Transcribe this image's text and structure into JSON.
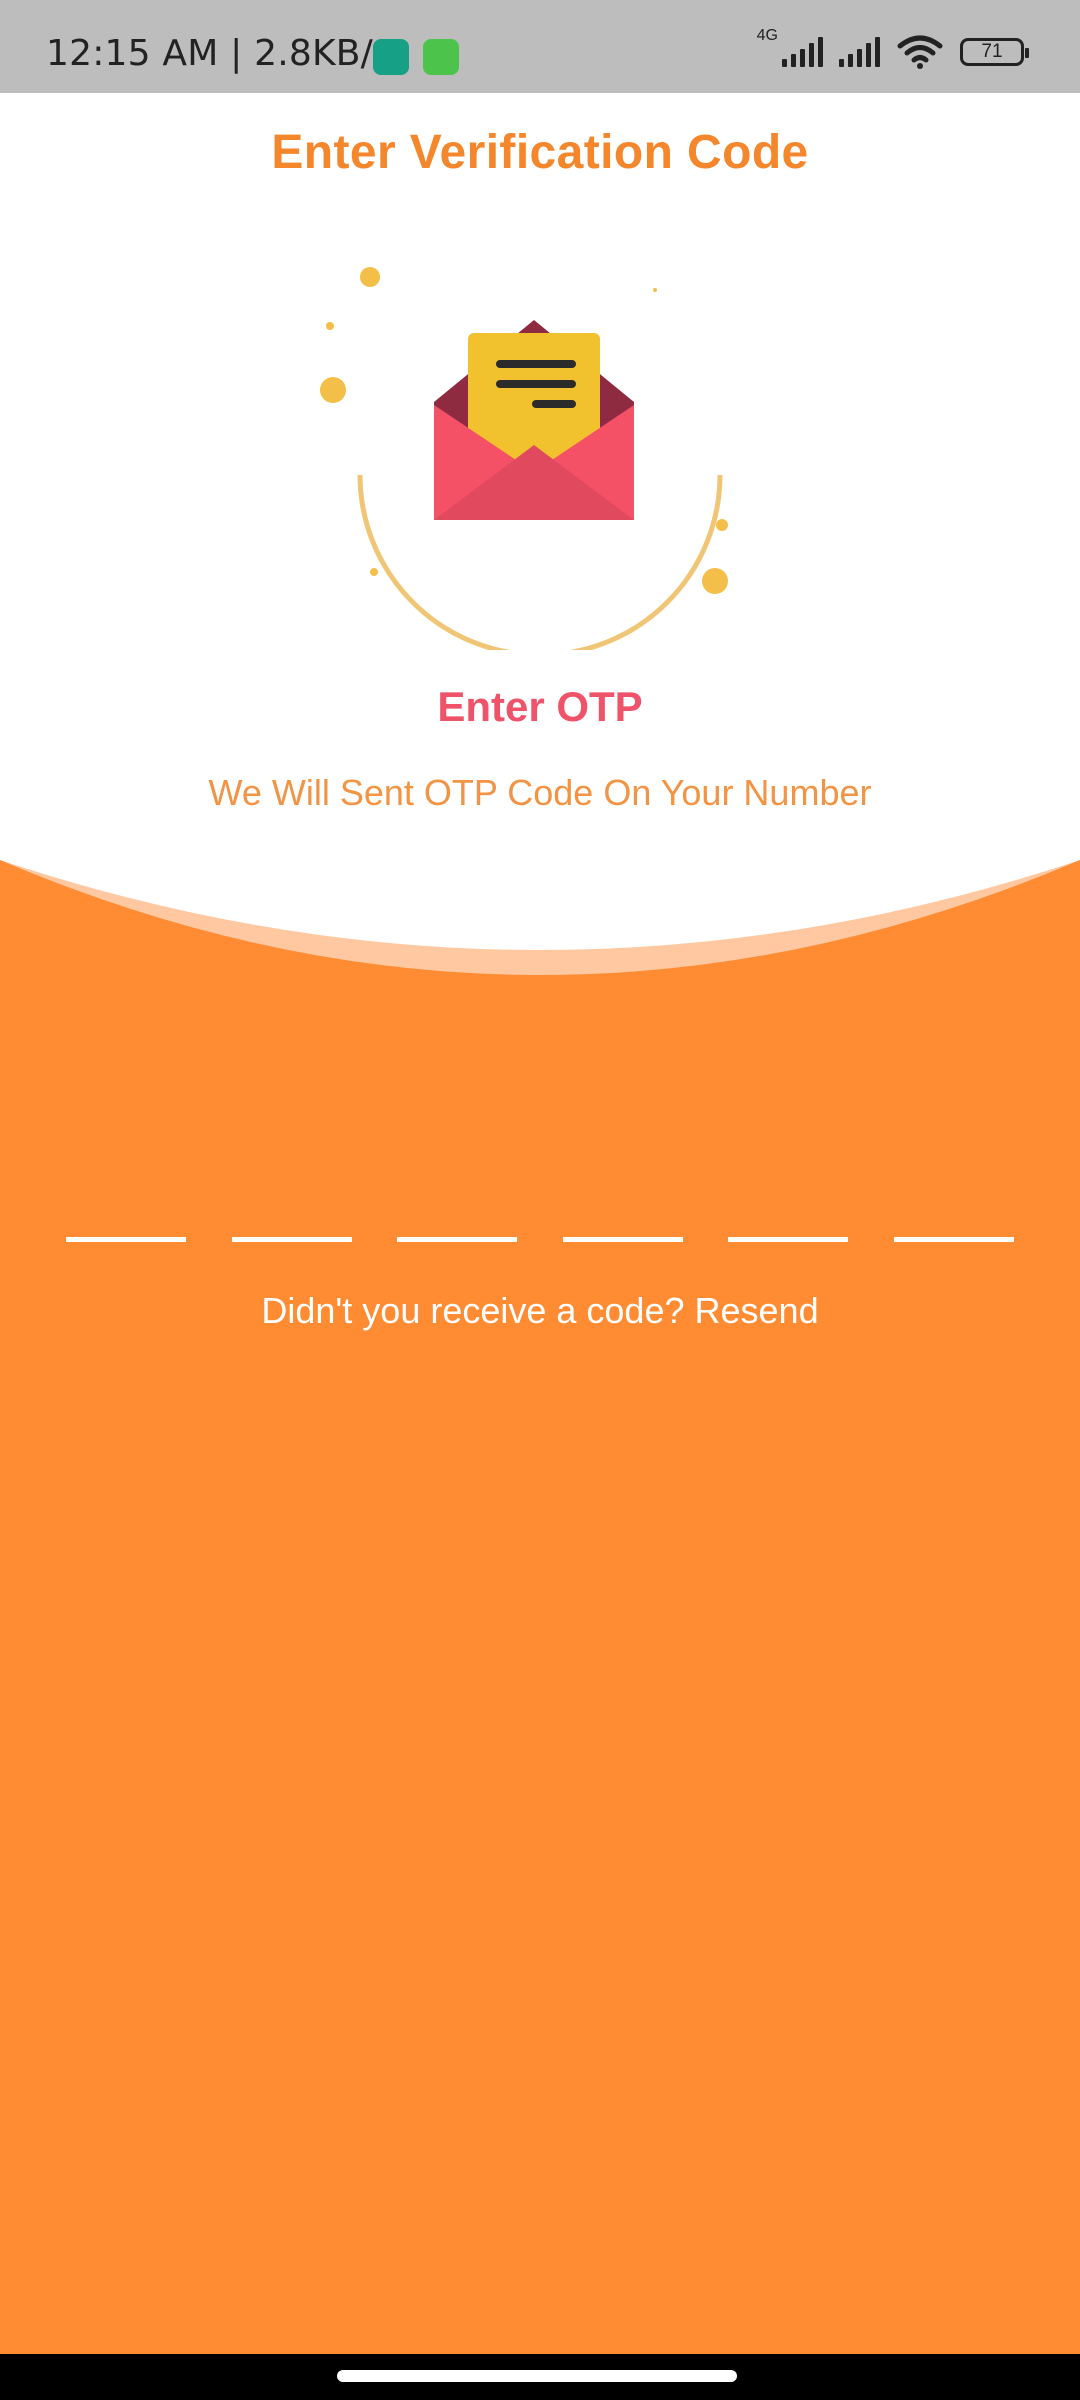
{
  "status_bar": {
    "time": "12:15 AM | 2.8KB/s",
    "network_label": "4G",
    "battery": "71",
    "icons": [
      "chat-app-icon",
      "cat-app-icon",
      "signal-icon",
      "signal-icon",
      "wifi-icon",
      "battery-icon"
    ]
  },
  "header": {
    "title": "Enter Verification Code"
  },
  "illustration": {
    "icon": "open-envelope-icon"
  },
  "content": {
    "heading": "Enter OTP",
    "subtitle": "We Will Sent OTP Code On Your Number"
  },
  "otp": {
    "cells": [
      "",
      "",
      "",
      "",
      "",
      ""
    ]
  },
  "resend": {
    "prompt": "Didn't you receive a code?",
    "link_label": "Resend"
  },
  "colors": {
    "accent_orange": "#ff8c33",
    "title_orange": "#f4862b",
    "heading_pink": "#ef5369",
    "envelope_red": "#f55166",
    "letter_yellow": "#f2c12e"
  }
}
